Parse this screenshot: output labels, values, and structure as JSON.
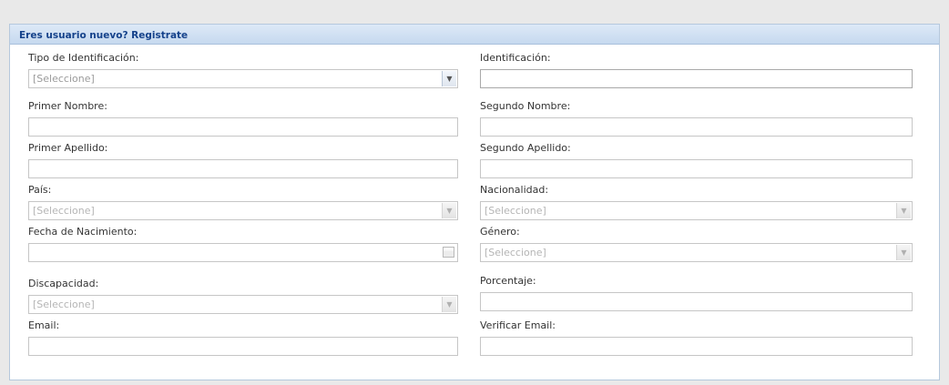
{
  "panel": {
    "title": "Eres usuario nuevo? Registrate"
  },
  "form": {
    "tipo_identificacion": {
      "label": "Tipo de Identificación:",
      "value": "[Seleccione]"
    },
    "identificacion": {
      "label": "Identificación:",
      "value": ""
    },
    "primer_nombre": {
      "label": "Primer Nombre:",
      "value": ""
    },
    "segundo_nombre": {
      "label": "Segundo Nombre:",
      "value": ""
    },
    "primer_apellido": {
      "label": "Primer Apellido:",
      "value": ""
    },
    "segundo_apellido": {
      "label": "Segundo Apellido:",
      "value": ""
    },
    "pais": {
      "label": "País:",
      "value": "[Seleccione]"
    },
    "nacionalidad": {
      "label": "Nacionalidad:",
      "value": "[Seleccione]"
    },
    "fecha_nacimiento": {
      "label": "Fecha de Nacimiento:",
      "value": ""
    },
    "genero": {
      "label": "Género:",
      "value": "[Seleccione]"
    },
    "discapacidad": {
      "label": "Discapacidad:",
      "value": "[Seleccione]"
    },
    "porcentaje": {
      "label": "Porcentaje:",
      "value": ""
    },
    "email": {
      "label": "Email:",
      "value": ""
    },
    "verificar_email": {
      "label": "Verificar Email:",
      "value": ""
    }
  },
  "icons": {
    "dropdown": "chevron-down-icon",
    "date_picker": "calendar-icon"
  },
  "colors": {
    "header_text": "#15428b",
    "header_bg": "#c6d9ef",
    "border": "#b5c8dd"
  }
}
